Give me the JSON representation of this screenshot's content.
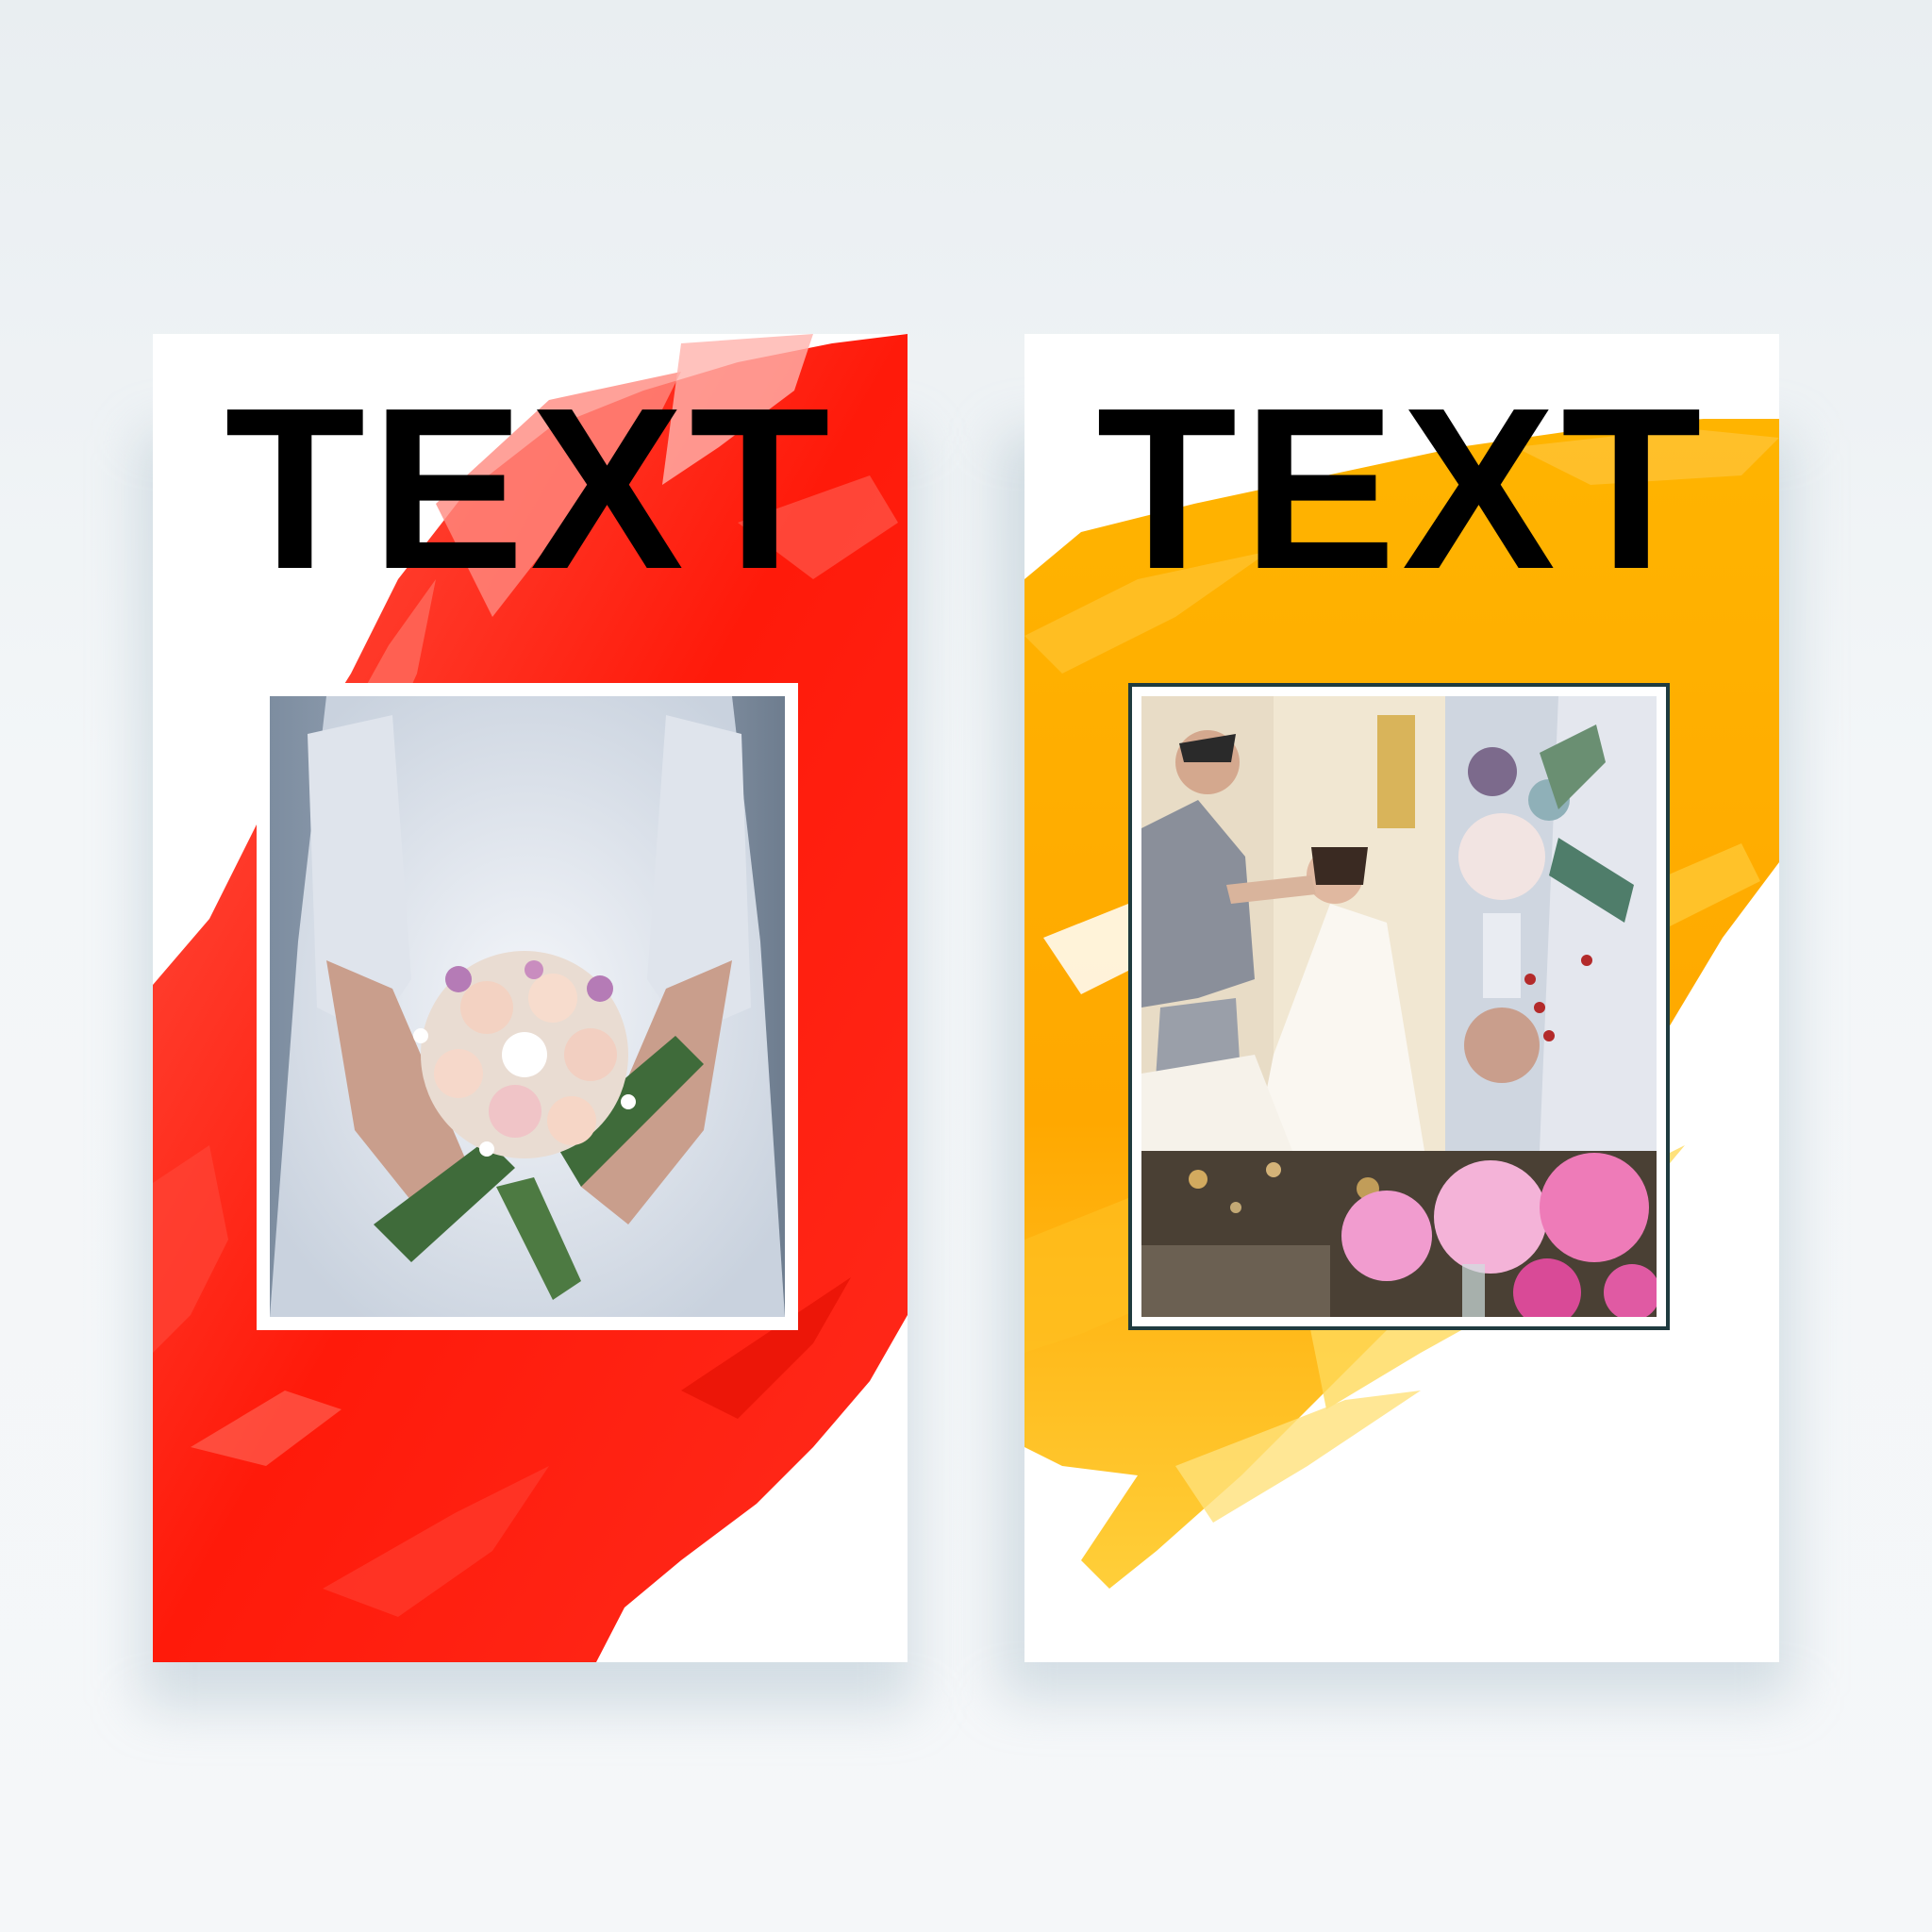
{
  "cards": [
    {
      "title": "TEXT",
      "accent_color": "#ff1a0a",
      "photo": "bridal-bouquet-photo"
    },
    {
      "title": "TEXT",
      "accent_color": "#ffab00",
      "photos": [
        "couple-photo",
        "bouquet-closeup-photo",
        "pink-flower-decor-photo"
      ]
    }
  ]
}
